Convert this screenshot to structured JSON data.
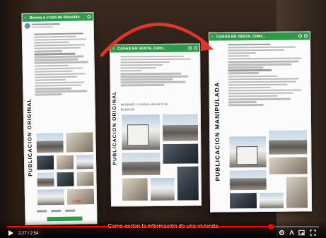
{
  "video": {
    "time_display": "2:27 / 2:54",
    "progress": 0.845,
    "caption": "Como cortan la información de una vivienda"
  },
  "posts": {
    "original": {
      "vertical_label": "PUBLICACION ORIGINAL",
      "bar_title": "Bienes a venta de Mazatlán",
      "price_tag": "1,995"
    },
    "middle": {
      "vertical_label": "PUBLICACION ORIGINAL",
      "bar_title": "CASAS EN VENTA, CHIH...",
      "footer_text": "INFORMES Y CITAS AL 614 181 02 28",
      "price_text": "$5,998,000"
    },
    "manipulated": {
      "vertical_label": "PUBLICACION MANIPULADA",
      "bar_title": "CASAS EN VENTA, CHIH..."
    }
  },
  "colors": {
    "fb_green": "#2e9a4a",
    "arrow_red": "#e0352b",
    "progress_red": "#ff0000"
  },
  "icons": [
    "play-icon",
    "settings-icon",
    "subtitles-icon",
    "miniplayer-icon",
    "fullscreen-icon",
    "back-arrow-icon"
  ]
}
